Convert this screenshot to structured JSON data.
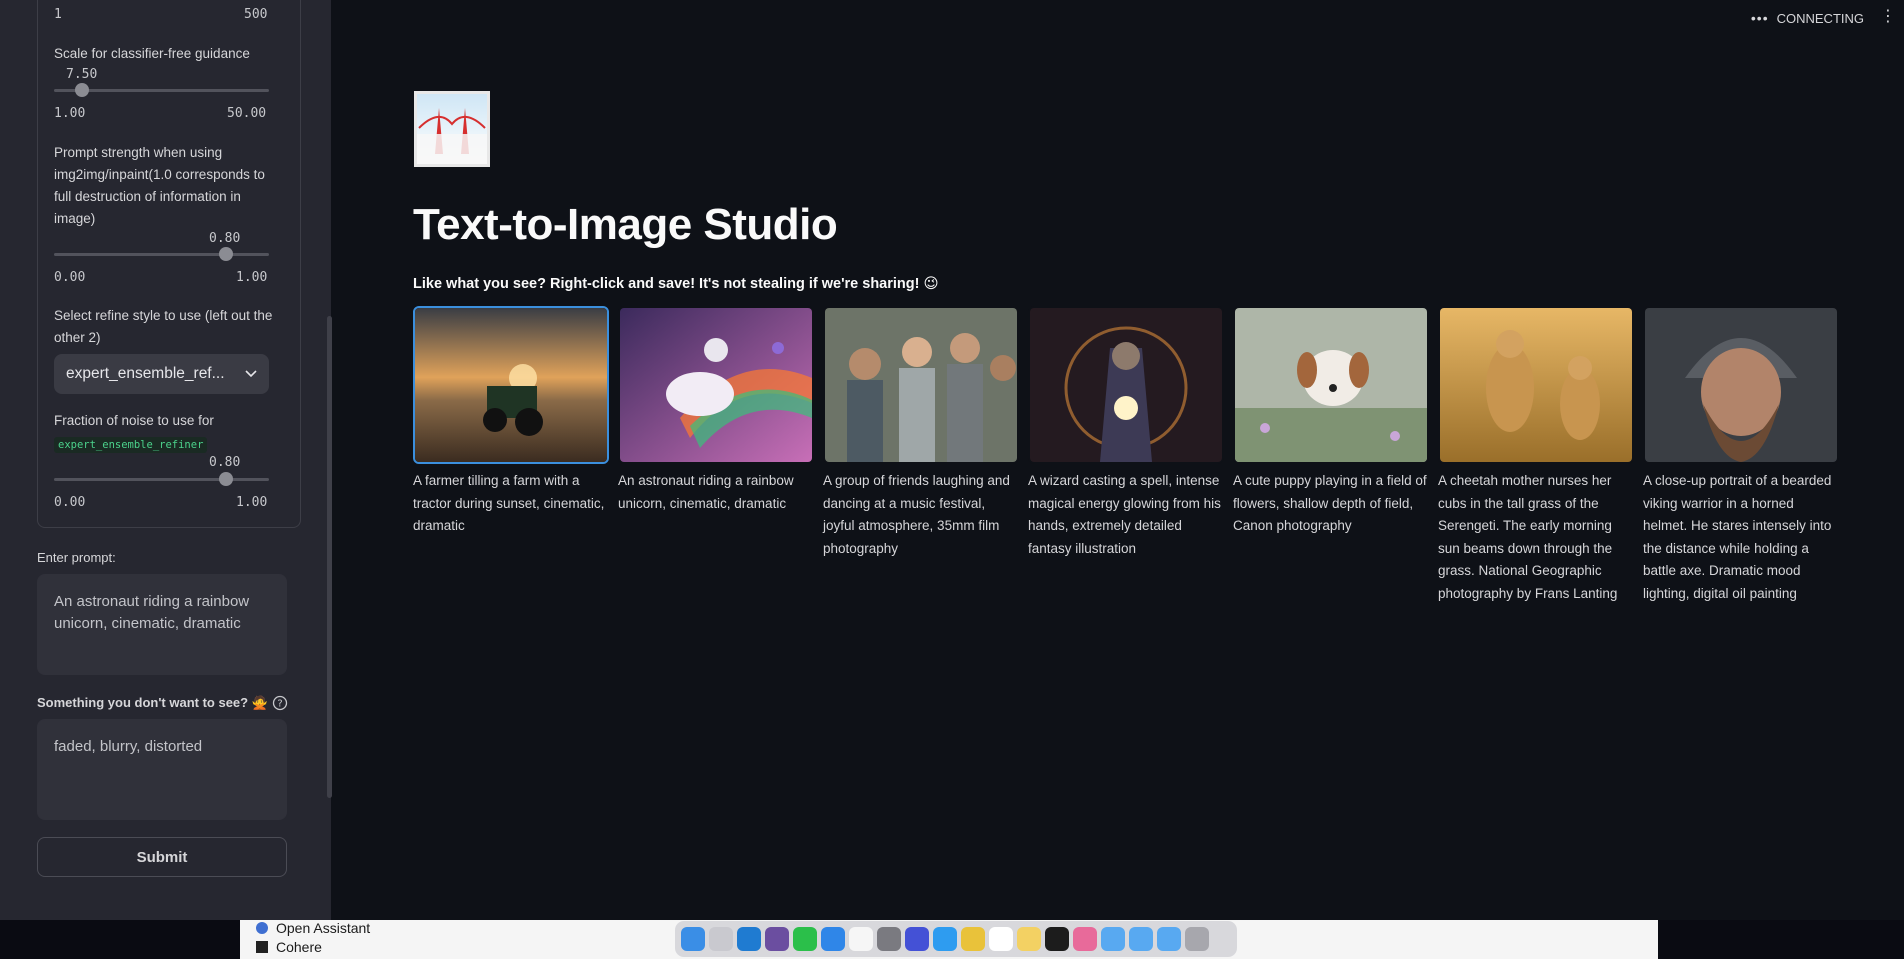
{
  "sidebar": {
    "steps_min": "1",
    "steps_max": "500",
    "guidance": {
      "label": "Scale for classifier-free guidance",
      "value": "7.50",
      "min": "1.00",
      "max": "50.00",
      "level": 0.133
    },
    "prompt_strength": {
      "label": "Prompt strength when using img2img/inpaint(1.0 corresponds to full destruction of information in image)",
      "value": "0.80",
      "min": "0.00",
      "max": "1.00",
      "level": 0.8
    },
    "refine_style": {
      "label": "Select refine style to use (left out the other 2)",
      "selected": "expert_ensemble_ref..."
    },
    "noise_fraction": {
      "label": "Fraction of noise to use for",
      "code": "expert_ensemble_refiner",
      "value": "0.80",
      "min": "0.00",
      "max": "1.00",
      "level": 0.8
    },
    "prompt": {
      "label": "Enter prompt:",
      "value": "An astronaut riding a rainbow unicorn, cinematic, dramatic"
    },
    "negative": {
      "label": "Something you don't want to see? 🙅",
      "value": "faded, blurry, distorted"
    },
    "submit_label": "Submit"
  },
  "header": {
    "status": "CONNECTING"
  },
  "main": {
    "title": "Text-to-Image Studio",
    "subtitle": "Like what you see? Right-click and save! It's not stealing if we're sharing! 😉",
    "gallery": [
      {
        "caption": "A farmer tilling a farm with a tractor during sunset, cinematic, dramatic"
      },
      {
        "caption": "An astronaut riding a rainbow unicorn, cinematic, dramatic"
      },
      {
        "caption": "A group of friends laughing and dancing at a music festival, joyful atmosphere, 35mm film photography"
      },
      {
        "caption": "A wizard casting a spell, intense magical energy glowing from his hands, extremely detailed fantasy illustration"
      },
      {
        "caption": "A cute puppy playing in a field of flowers, shallow depth of field, Canon photography"
      },
      {
        "caption": "A cheetah mother nurses her cubs in the tall grass of the Serengeti. The early morning sun beams down through the grass. National Geographic photography by Frans Lanting"
      },
      {
        "caption": "A close-up portrait of a bearded viking warrior in a horned helmet. He stares intensely into the distance while holding a battle axe. Dramatic mood lighting, digital oil painting"
      }
    ]
  },
  "taskbar": {
    "items": [
      "Open Assistant",
      "Cohere"
    ]
  }
}
